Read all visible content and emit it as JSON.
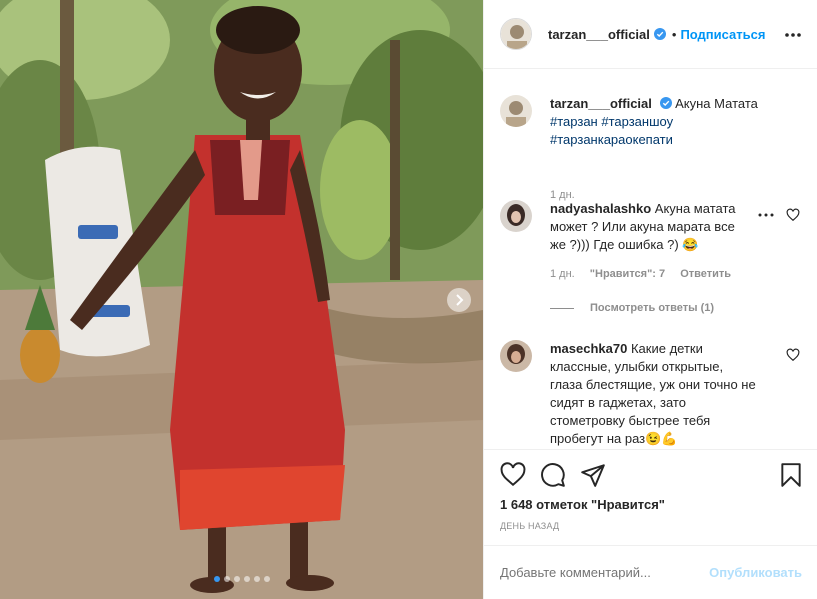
{
  "post": {
    "author": "tarzan___official",
    "follow_label": "Подписаться",
    "separator": "•",
    "photo_alt": "",
    "carousel_dots": 6,
    "carousel_active": 0
  },
  "caption": {
    "username": "tarzan___official",
    "text": "Акуна Матата",
    "hashtags": [
      "#тарзан",
      "#тарзаншоу",
      "#тарзанкараокепати"
    ],
    "time": "1 дн."
  },
  "comments": [
    {
      "username": "nadyashalashko",
      "text": "Акуна матата может ? Или акуна марата все же ?))) Где ошибка ?) 😂",
      "time": "1 дн.",
      "likes": "\"Нравится\": 7",
      "reply_label": "Ответить",
      "view_replies": "Посмотреть ответы (1)"
    },
    {
      "username": "masechka70",
      "text": "Какие детки классные, улыбки открытые, глаза блестящие, уж они точно не сидят в гаджетах, зато стометровку быстрее тебя пробегут на раз😉💪"
    }
  ],
  "stats": {
    "likes": "1 648 отметок \"Нравится\"",
    "posted": "ДЕНЬ НАЗАД"
  },
  "add_comment": {
    "placeholder": "Добавьте комментарий...",
    "publish_label": "Опубликовать"
  },
  "colors": {
    "link_blue": "#0095f6",
    "muted": "#8e8e8e",
    "publish_disabled": "#b2dffc"
  }
}
